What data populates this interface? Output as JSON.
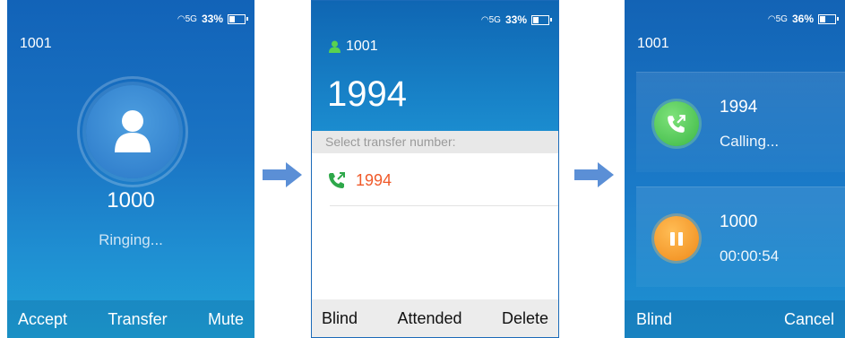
{
  "colors": {
    "screen_blue": "#1a74c4",
    "accent_orange": "#f05a2a",
    "call_green": "#3cb846",
    "hold_orange": "#f08a1a",
    "arrow_blue": "#5b8fd6"
  },
  "screen1": {
    "status": {
      "signal_label": "5G",
      "battery_text": "33%",
      "battery_level": 0.33
    },
    "account": "1001",
    "avatar_icon": "person-icon",
    "caller_number": "1000",
    "call_status": "Ringing...",
    "softkeys": [
      "Accept",
      "Transfer",
      "Mute"
    ]
  },
  "screen2": {
    "status": {
      "signal_label": "5G",
      "battery_text": "33%",
      "battery_level": 0.33
    },
    "account": "1001",
    "account_icon": "person-icon",
    "dialed_number": "1994",
    "prompt": "Select transfer number:",
    "list": [
      {
        "label": "1994",
        "icon": "outgoing-call-icon"
      }
    ],
    "softkeys": [
      "Blind",
      "Attended",
      "Delete"
    ]
  },
  "screen3": {
    "status": {
      "signal_label": "5G",
      "battery_text": "36%",
      "battery_level": 0.36
    },
    "account": "1001",
    "calls": [
      {
        "number": "1994",
        "status": "Calling...",
        "icon": "outgoing-call-icon"
      },
      {
        "number": "1000",
        "status": "00:00:54",
        "icon": "hold-icon"
      }
    ],
    "softkeys": [
      "Blind",
      "Cancel"
    ]
  },
  "arrows": [
    "arrow-right-icon",
    "arrow-right-icon"
  ]
}
